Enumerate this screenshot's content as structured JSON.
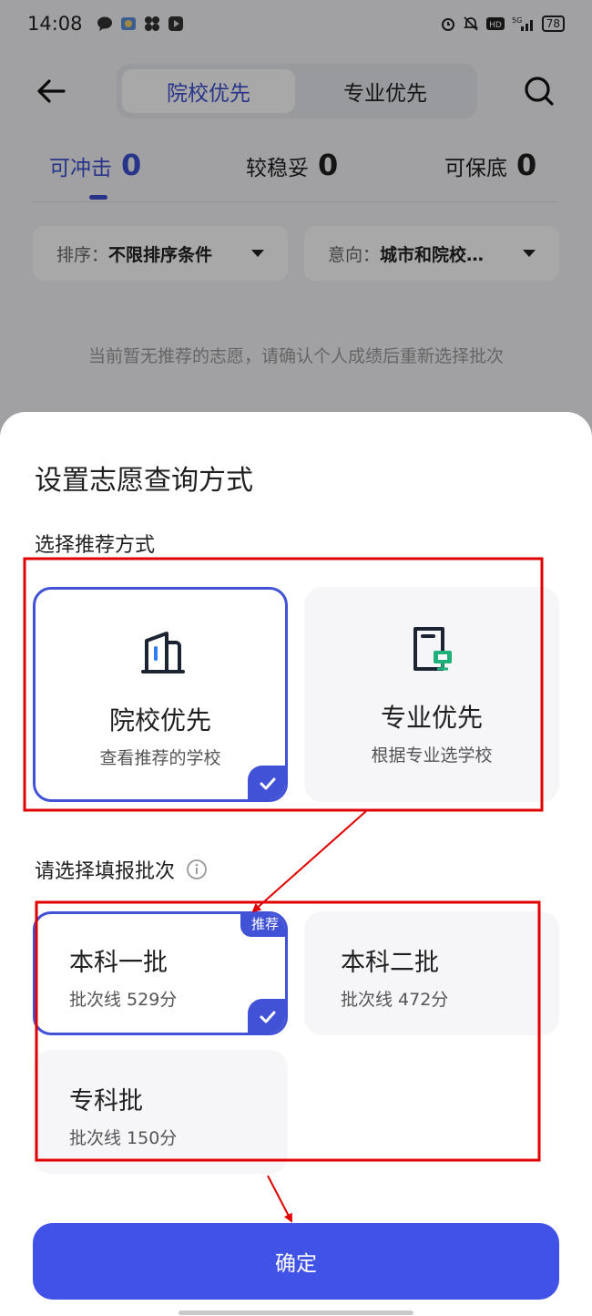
{
  "status_bar": {
    "time": "14:08",
    "battery": "78"
  },
  "header": {
    "segment_tabs": [
      "院校优先",
      "专业优先"
    ]
  },
  "counts": [
    {
      "label": "可冲击",
      "value": "0"
    },
    {
      "label": "较稳妥",
      "value": "0"
    },
    {
      "label": "可保底",
      "value": "0"
    }
  ],
  "filters": [
    {
      "key": "排序：",
      "value": "不限排序条件"
    },
    {
      "key": "意向：",
      "value": "城市和院校…"
    }
  ],
  "empty_message": "当前暂无推荐的志愿，请确认个人成绩后重新选择批次",
  "sheet": {
    "title": "设置志愿查询方式",
    "method_section_label": "选择推荐方式",
    "methods": [
      {
        "title": "院校优先",
        "subtitle": "查看推荐的学校",
        "icon": "building-icon",
        "selected": true
      },
      {
        "title": "专业优先",
        "subtitle": "根据专业选学校",
        "icon": "book-monitor-icon",
        "selected": false
      }
    ],
    "batch_section_label": "请选择填报批次",
    "batches": [
      {
        "title": "本科一批",
        "subtitle": "批次线 529分",
        "badge": "推荐",
        "selected": true
      },
      {
        "title": "本科二批",
        "subtitle": "批次线 472分",
        "selected": false
      },
      {
        "title": "专科批",
        "subtitle": "批次线 150分",
        "selected": false
      }
    ],
    "confirm_label": "确定"
  },
  "colors": {
    "accent": "#4152d6",
    "annotation": "#e00000"
  }
}
